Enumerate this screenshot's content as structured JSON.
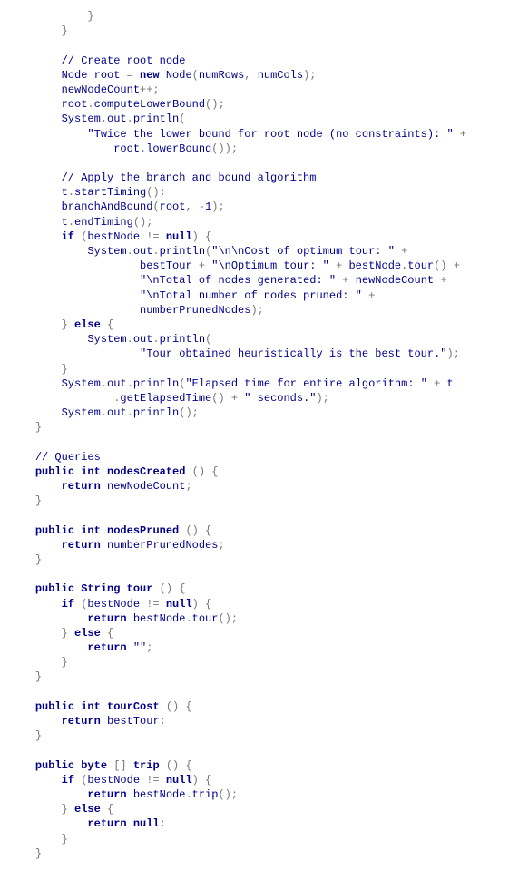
{
  "lines": [
    {
      "indent": 12,
      "parts": [
        {
          "t": "}",
          "c": "p"
        }
      ]
    },
    {
      "indent": 8,
      "parts": [
        {
          "t": "}",
          "c": "p"
        }
      ]
    },
    {
      "indent": 0,
      "parts": [
        {
          "t": "",
          "c": "p"
        }
      ]
    },
    {
      "indent": 8,
      "parts": [
        {
          "t": "// Create root node",
          "c": "c"
        }
      ]
    },
    {
      "indent": 8,
      "parts": [
        {
          "t": "Node root ",
          "c": "n"
        },
        {
          "t": "= ",
          "c": "p"
        },
        {
          "t": "new ",
          "c": "k"
        },
        {
          "t": "Node",
          "c": "n"
        },
        {
          "t": "(",
          "c": "p"
        },
        {
          "t": "numRows",
          "c": "n"
        },
        {
          "t": ", ",
          "c": "p"
        },
        {
          "t": "numCols",
          "c": "n"
        },
        {
          "t": ");",
          "c": "p"
        }
      ]
    },
    {
      "indent": 8,
      "parts": [
        {
          "t": "newNodeCount",
          "c": "n"
        },
        {
          "t": "++;",
          "c": "p"
        }
      ]
    },
    {
      "indent": 8,
      "parts": [
        {
          "t": "root",
          "c": "n"
        },
        {
          "t": ".",
          "c": "p"
        },
        {
          "t": "computeLowerBound",
          "c": "n"
        },
        {
          "t": "();",
          "c": "p"
        }
      ]
    },
    {
      "indent": 8,
      "parts": [
        {
          "t": "System",
          "c": "n"
        },
        {
          "t": ".",
          "c": "p"
        },
        {
          "t": "out",
          "c": "n"
        },
        {
          "t": ".",
          "c": "p"
        },
        {
          "t": "println",
          "c": "n"
        },
        {
          "t": "(",
          "c": "p"
        }
      ]
    },
    {
      "indent": 12,
      "parts": [
        {
          "t": "\"Twice the lower bound for root node (no constraints): \" ",
          "c": "s"
        },
        {
          "t": "+",
          "c": "p"
        }
      ]
    },
    {
      "indent": 16,
      "parts": [
        {
          "t": "root",
          "c": "n"
        },
        {
          "t": ".",
          "c": "p"
        },
        {
          "t": "lowerBound",
          "c": "n"
        },
        {
          "t": "());",
          "c": "p"
        }
      ]
    },
    {
      "indent": 0,
      "parts": [
        {
          "t": "",
          "c": "p"
        }
      ]
    },
    {
      "indent": 8,
      "parts": [
        {
          "t": "// Apply the branch and bound algorithm",
          "c": "c"
        }
      ]
    },
    {
      "indent": 8,
      "parts": [
        {
          "t": "t",
          "c": "n"
        },
        {
          "t": ".",
          "c": "p"
        },
        {
          "t": "startTiming",
          "c": "n"
        },
        {
          "t": "();",
          "c": "p"
        }
      ]
    },
    {
      "indent": 8,
      "parts": [
        {
          "t": "branchAndBound",
          "c": "n"
        },
        {
          "t": "(",
          "c": "p"
        },
        {
          "t": "root",
          "c": "n"
        },
        {
          "t": ", -",
          "c": "p"
        },
        {
          "t": "1",
          "c": "n"
        },
        {
          "t": ");",
          "c": "p"
        }
      ]
    },
    {
      "indent": 8,
      "parts": [
        {
          "t": "t",
          "c": "n"
        },
        {
          "t": ".",
          "c": "p"
        },
        {
          "t": "endTiming",
          "c": "n"
        },
        {
          "t": "();",
          "c": "p"
        }
      ]
    },
    {
      "indent": 8,
      "parts": [
        {
          "t": "if ",
          "c": "k"
        },
        {
          "t": "(",
          "c": "p"
        },
        {
          "t": "bestNode ",
          "c": "n"
        },
        {
          "t": "!= ",
          "c": "p"
        },
        {
          "t": "null",
          "c": "k"
        },
        {
          "t": ") {",
          "c": "p"
        }
      ]
    },
    {
      "indent": 12,
      "parts": [
        {
          "t": "System",
          "c": "n"
        },
        {
          "t": ".",
          "c": "p"
        },
        {
          "t": "out",
          "c": "n"
        },
        {
          "t": ".",
          "c": "p"
        },
        {
          "t": "println",
          "c": "n"
        },
        {
          "t": "(",
          "c": "p"
        },
        {
          "t": "\"\\n\\nCost of optimum tour: \" ",
          "c": "s"
        },
        {
          "t": "+",
          "c": "p"
        }
      ]
    },
    {
      "indent": 20,
      "parts": [
        {
          "t": "bestTour ",
          "c": "n"
        },
        {
          "t": "+ ",
          "c": "p"
        },
        {
          "t": "\"\\nOptimum tour: \" ",
          "c": "s"
        },
        {
          "t": "+ ",
          "c": "p"
        },
        {
          "t": "bestNode",
          "c": "n"
        },
        {
          "t": ".",
          "c": "p"
        },
        {
          "t": "tour",
          "c": "n"
        },
        {
          "t": "() +",
          "c": "p"
        }
      ]
    },
    {
      "indent": 20,
      "parts": [
        {
          "t": "\"\\nTotal of nodes generated: \" ",
          "c": "s"
        },
        {
          "t": "+ ",
          "c": "p"
        },
        {
          "t": "newNodeCount ",
          "c": "n"
        },
        {
          "t": "+",
          "c": "p"
        }
      ]
    },
    {
      "indent": 20,
      "parts": [
        {
          "t": "\"\\nTotal number of nodes pruned: \" ",
          "c": "s"
        },
        {
          "t": "+",
          "c": "p"
        }
      ]
    },
    {
      "indent": 20,
      "parts": [
        {
          "t": "numberPrunedNodes",
          "c": "n"
        },
        {
          "t": ");",
          "c": "p"
        }
      ]
    },
    {
      "indent": 8,
      "parts": [
        {
          "t": "} ",
          "c": "p"
        },
        {
          "t": "else ",
          "c": "k"
        },
        {
          "t": "{",
          "c": "p"
        }
      ]
    },
    {
      "indent": 12,
      "parts": [
        {
          "t": "System",
          "c": "n"
        },
        {
          "t": ".",
          "c": "p"
        },
        {
          "t": "out",
          "c": "n"
        },
        {
          "t": ".",
          "c": "p"
        },
        {
          "t": "println",
          "c": "n"
        },
        {
          "t": "(",
          "c": "p"
        }
      ]
    },
    {
      "indent": 20,
      "parts": [
        {
          "t": "\"Tour obtained heuristically is the best tour.\"",
          "c": "s"
        },
        {
          "t": ");",
          "c": "p"
        }
      ]
    },
    {
      "indent": 8,
      "parts": [
        {
          "t": "}",
          "c": "p"
        }
      ]
    },
    {
      "indent": 8,
      "parts": [
        {
          "t": "System",
          "c": "n"
        },
        {
          "t": ".",
          "c": "p"
        },
        {
          "t": "out",
          "c": "n"
        },
        {
          "t": ".",
          "c": "p"
        },
        {
          "t": "println",
          "c": "n"
        },
        {
          "t": "(",
          "c": "p"
        },
        {
          "t": "\"Elapsed time for entire algorithm: \" ",
          "c": "s"
        },
        {
          "t": "+ ",
          "c": "p"
        },
        {
          "t": "t",
          "c": "n"
        }
      ]
    },
    {
      "indent": 16,
      "parts": [
        {
          "t": ".",
          "c": "p"
        },
        {
          "t": "getElapsedTime",
          "c": "n"
        },
        {
          "t": "() + ",
          "c": "p"
        },
        {
          "t": "\" seconds.\"",
          "c": "s"
        },
        {
          "t": ");",
          "c": "p"
        }
      ]
    },
    {
      "indent": 8,
      "parts": [
        {
          "t": "System",
          "c": "n"
        },
        {
          "t": ".",
          "c": "p"
        },
        {
          "t": "out",
          "c": "n"
        },
        {
          "t": ".",
          "c": "p"
        },
        {
          "t": "println",
          "c": "n"
        },
        {
          "t": "();",
          "c": "p"
        }
      ]
    },
    {
      "indent": 4,
      "parts": [
        {
          "t": "}",
          "c": "p"
        }
      ]
    },
    {
      "indent": 0,
      "parts": [
        {
          "t": "",
          "c": "p"
        }
      ]
    },
    {
      "indent": 4,
      "parts": [
        {
          "t": "// Queries",
          "c": "c"
        }
      ]
    },
    {
      "indent": 4,
      "parts": [
        {
          "t": "public int ",
          "c": "k"
        },
        {
          "t": "nodesCreated ",
          "c": "k"
        },
        {
          "t": "() {",
          "c": "p"
        }
      ]
    },
    {
      "indent": 8,
      "parts": [
        {
          "t": "return ",
          "c": "k"
        },
        {
          "t": "newNodeCount",
          "c": "n"
        },
        {
          "t": ";",
          "c": "p"
        }
      ]
    },
    {
      "indent": 4,
      "parts": [
        {
          "t": "}",
          "c": "p"
        }
      ]
    },
    {
      "indent": 0,
      "parts": [
        {
          "t": "",
          "c": "p"
        }
      ]
    },
    {
      "indent": 4,
      "parts": [
        {
          "t": "public int ",
          "c": "k"
        },
        {
          "t": "nodesPruned ",
          "c": "k"
        },
        {
          "t": "() {",
          "c": "p"
        }
      ]
    },
    {
      "indent": 8,
      "parts": [
        {
          "t": "return ",
          "c": "k"
        },
        {
          "t": "numberPrunedNodes",
          "c": "n"
        },
        {
          "t": ";",
          "c": "p"
        }
      ]
    },
    {
      "indent": 4,
      "parts": [
        {
          "t": "}",
          "c": "p"
        }
      ]
    },
    {
      "indent": 0,
      "parts": [
        {
          "t": "",
          "c": "p"
        }
      ]
    },
    {
      "indent": 4,
      "parts": [
        {
          "t": "public ",
          "c": "k"
        },
        {
          "t": "String ",
          "c": "k"
        },
        {
          "t": "tour ",
          "c": "k"
        },
        {
          "t": "() {",
          "c": "p"
        }
      ]
    },
    {
      "indent": 8,
      "parts": [
        {
          "t": "if ",
          "c": "k"
        },
        {
          "t": "(",
          "c": "p"
        },
        {
          "t": "bestNode ",
          "c": "n"
        },
        {
          "t": "!= ",
          "c": "p"
        },
        {
          "t": "null",
          "c": "k"
        },
        {
          "t": ") {",
          "c": "p"
        }
      ]
    },
    {
      "indent": 12,
      "parts": [
        {
          "t": "return ",
          "c": "k"
        },
        {
          "t": "bestNode",
          "c": "n"
        },
        {
          "t": ".",
          "c": "p"
        },
        {
          "t": "tour",
          "c": "n"
        },
        {
          "t": "();",
          "c": "p"
        }
      ]
    },
    {
      "indent": 8,
      "parts": [
        {
          "t": "} ",
          "c": "p"
        },
        {
          "t": "else ",
          "c": "k"
        },
        {
          "t": "{",
          "c": "p"
        }
      ]
    },
    {
      "indent": 12,
      "parts": [
        {
          "t": "return ",
          "c": "k"
        },
        {
          "t": "\"\"",
          "c": "s"
        },
        {
          "t": ";",
          "c": "p"
        }
      ]
    },
    {
      "indent": 8,
      "parts": [
        {
          "t": "}",
          "c": "p"
        }
      ]
    },
    {
      "indent": 4,
      "parts": [
        {
          "t": "}",
          "c": "p"
        }
      ]
    },
    {
      "indent": 0,
      "parts": [
        {
          "t": "",
          "c": "p"
        }
      ]
    },
    {
      "indent": 4,
      "parts": [
        {
          "t": "public int ",
          "c": "k"
        },
        {
          "t": "tourCost ",
          "c": "k"
        },
        {
          "t": "() {",
          "c": "p"
        }
      ]
    },
    {
      "indent": 8,
      "parts": [
        {
          "t": "return ",
          "c": "k"
        },
        {
          "t": "bestTour",
          "c": "n"
        },
        {
          "t": ";",
          "c": "p"
        }
      ]
    },
    {
      "indent": 4,
      "parts": [
        {
          "t": "}",
          "c": "p"
        }
      ]
    },
    {
      "indent": 0,
      "parts": [
        {
          "t": "",
          "c": "p"
        }
      ]
    },
    {
      "indent": 4,
      "parts": [
        {
          "t": "public byte ",
          "c": "k"
        },
        {
          "t": "[] ",
          "c": "p"
        },
        {
          "t": "trip ",
          "c": "k"
        },
        {
          "t": "() {",
          "c": "p"
        }
      ]
    },
    {
      "indent": 8,
      "parts": [
        {
          "t": "if ",
          "c": "k"
        },
        {
          "t": "(",
          "c": "p"
        },
        {
          "t": "bestNode ",
          "c": "n"
        },
        {
          "t": "!= ",
          "c": "p"
        },
        {
          "t": "null",
          "c": "k"
        },
        {
          "t": ") {",
          "c": "p"
        }
      ]
    },
    {
      "indent": 12,
      "parts": [
        {
          "t": "return ",
          "c": "k"
        },
        {
          "t": "bestNode",
          "c": "n"
        },
        {
          "t": ".",
          "c": "p"
        },
        {
          "t": "trip",
          "c": "n"
        },
        {
          "t": "();",
          "c": "p"
        }
      ]
    },
    {
      "indent": 8,
      "parts": [
        {
          "t": "} ",
          "c": "p"
        },
        {
          "t": "else ",
          "c": "k"
        },
        {
          "t": "{",
          "c": "p"
        }
      ]
    },
    {
      "indent": 12,
      "parts": [
        {
          "t": "return null",
          "c": "k"
        },
        {
          "t": ";",
          "c": "p"
        }
      ]
    },
    {
      "indent": 8,
      "parts": [
        {
          "t": "}",
          "c": "p"
        }
      ]
    },
    {
      "indent": 4,
      "parts": [
        {
          "t": "}",
          "c": "p"
        }
      ]
    }
  ]
}
